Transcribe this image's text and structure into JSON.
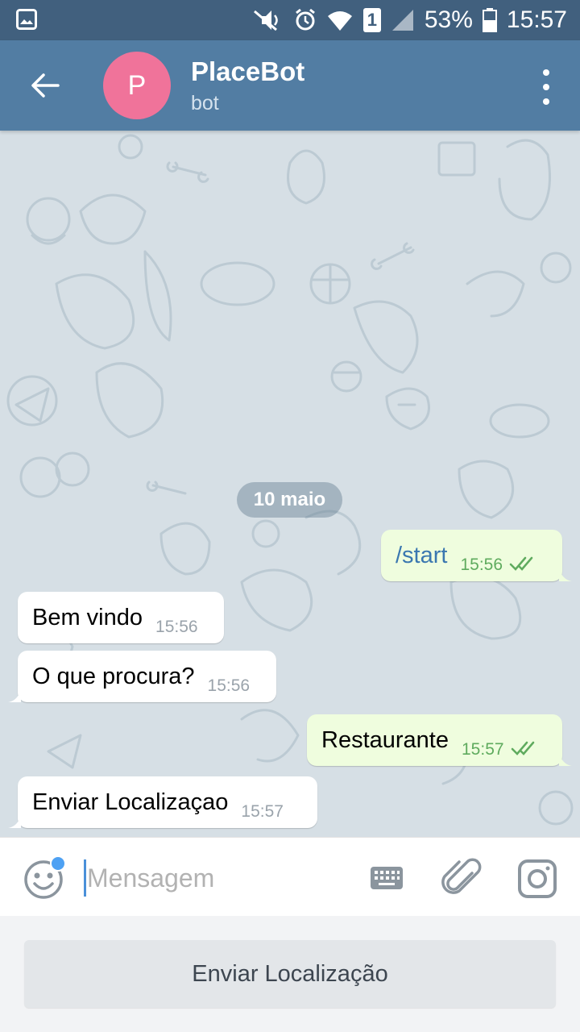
{
  "status_bar": {
    "battery": "53%",
    "clock": "15:57",
    "sim": "1"
  },
  "header": {
    "avatar_letter": "P",
    "title": "PlaceBot",
    "subtitle": "bot"
  },
  "chat": {
    "date": "10 maio",
    "messages": [
      {
        "direction": "out",
        "text": "/start",
        "time": "15:56",
        "status": "read"
      },
      {
        "direction": "in",
        "text": "Bem vindo",
        "time": "15:56"
      },
      {
        "direction": "in",
        "text": "O que procura?",
        "time": "15:56"
      },
      {
        "direction": "out",
        "text": "Restaurante",
        "time": "15:57",
        "status": "read"
      },
      {
        "direction": "in",
        "text": "Enviar Localizaçao",
        "time": "15:57"
      }
    ]
  },
  "composer": {
    "placeholder": "Mensagem"
  },
  "keyboard": {
    "button_label": "Enviar Localização"
  },
  "colors": {
    "status_bar": "#41607e",
    "header": "#527da3",
    "avatar": "#f0739a",
    "outgoing_bubble": "#effdde",
    "incoming_bubble": "#ffffff",
    "link_text": "#3a77b0"
  },
  "icons": {
    "back": "arrow-left-icon",
    "menu": "more-vertical-icon",
    "emoji": "smile-icon",
    "keyboard": "keyboard-icon",
    "attach": "paperclip-icon",
    "camera": "camera-icon"
  }
}
